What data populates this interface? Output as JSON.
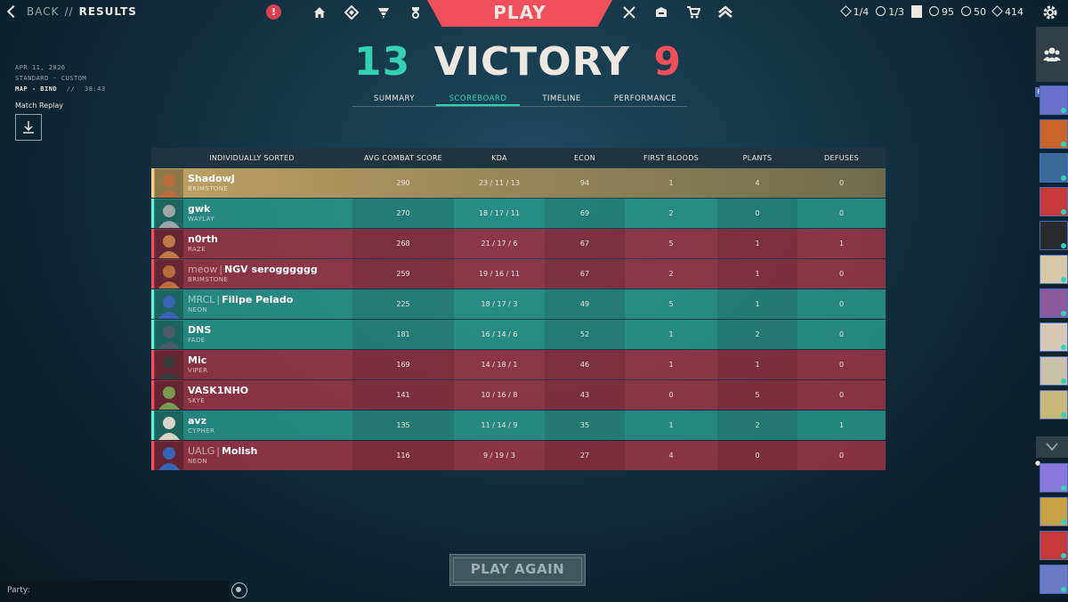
{
  "nav": {
    "back_label": "BACK",
    "separator": "//",
    "section_title": "RESULTS",
    "alert_icon": "!",
    "play_label": "PLAY",
    "left_icons": [
      "home-icon",
      "career-icon",
      "collection-icon",
      "battlepass-icon"
    ],
    "right_icons": [
      "agents-icon",
      "store-box-icon",
      "store-cart-icon",
      "rank-icon"
    ]
  },
  "currency": {
    "missions": "1/4",
    "challenges": "1/3",
    "valorant_points": "95",
    "radianite": "50",
    "kingdom_credits": "414"
  },
  "match": {
    "date": "APR 11, 2026",
    "mode": "STANDARD - CUSTOM",
    "map": "MAP - BIND",
    "map_separator": "//",
    "duration": "38:43",
    "replay_label": "Match Replay",
    "score_ally": "13",
    "result": "VICTORY",
    "score_enemy": "9"
  },
  "tabs": [
    "SUMMARY",
    "SCOREBOARD",
    "TIMELINE",
    "PERFORMANCE"
  ],
  "active_tab": "SCOREBOARD",
  "columns": [
    "INDIVIDUALLY SORTED",
    "AVG COMBAT SCORE",
    "KDA",
    "ECON",
    "FIRST BLOODS",
    "PLANTS",
    "DEFUSES"
  ],
  "players": [
    {
      "team": "self",
      "tag": "",
      "name": "ShadowJ",
      "agent": "BRIMSTONE",
      "acs": "290",
      "kda": "23 / 11 / 13",
      "econ": "94",
      "first_bloods": "1",
      "plants": "4",
      "defuses": "0",
      "avatar_color": "#b86d3a"
    },
    {
      "team": "ally",
      "tag": "",
      "name": "gwk",
      "agent": "WAYLAY",
      "acs": "270",
      "kda": "18 / 17 / 11",
      "econ": "69",
      "first_bloods": "2",
      "plants": "0",
      "defuses": "0",
      "avatar_color": "#9aa7a6"
    },
    {
      "team": "enemy",
      "tag": "",
      "name": "n0rth",
      "agent": "RAZE",
      "acs": "268",
      "kda": "21 / 17 / 6",
      "econ": "67",
      "first_bloods": "5",
      "plants": "1",
      "defuses": "1",
      "avatar_color": "#c07a45"
    },
    {
      "team": "enemy",
      "tag": "meow",
      "name": "NGV serogggggg",
      "agent": "BRIMSTONE",
      "acs": "259",
      "kda": "19 / 16 / 11",
      "econ": "67",
      "first_bloods": "2",
      "plants": "1",
      "defuses": "0",
      "avatar_color": "#b86d3a"
    },
    {
      "team": "ally",
      "tag": "MRCL",
      "name": "Filipe Pelado",
      "agent": "NEON",
      "acs": "225",
      "kda": "18 / 17 / 3",
      "econ": "49",
      "first_bloods": "5",
      "plants": "1",
      "defuses": "0",
      "avatar_color": "#3a62b5"
    },
    {
      "team": "ally",
      "tag": "",
      "name": "DNS",
      "agent": "FADE",
      "acs": "181",
      "kda": "16 / 14 / 6",
      "econ": "52",
      "first_bloods": "1",
      "plants": "2",
      "defuses": "0",
      "avatar_color": "#4a5a66"
    },
    {
      "team": "enemy",
      "tag": "",
      "name": "Mic",
      "agent": "VIPER",
      "acs": "169",
      "kda": "14 / 18 / 1",
      "econ": "46",
      "first_bloods": "1",
      "plants": "1",
      "defuses": "0",
      "avatar_color": "#3a3a3e"
    },
    {
      "team": "enemy",
      "tag": "",
      "name": "VASK1NHO",
      "agent": "SKYE",
      "acs": "141",
      "kda": "10 / 16 / 8",
      "econ": "43",
      "first_bloods": "0",
      "plants": "5",
      "defuses": "0",
      "avatar_color": "#7a9a52"
    },
    {
      "team": "ally",
      "tag": "",
      "name": "avz",
      "agent": "CYPHER",
      "acs": "135",
      "kda": "11 / 14 / 9",
      "econ": "35",
      "first_bloods": "1",
      "plants": "2",
      "defuses": "1",
      "avatar_color": "#d8d4c8"
    },
    {
      "team": "enemy",
      "tag": "UALG",
      "name": "Molish",
      "agent": "NEON",
      "acs": "116",
      "kda": "9 / 19 / 3",
      "econ": "27",
      "first_bloods": "4",
      "plants": "0",
      "defuses": "0",
      "avatar_color": "#3a62b5"
    }
  ],
  "play_again_label": "PLAY AGAIN",
  "party_label": "Party:",
  "social": {
    "online_count": "8",
    "friends_colors": [
      "#6a6fc8",
      "#c8642a",
      "#3a6a9a",
      "#c83a3a",
      "#2a2a2e",
      "#d8c8a8",
      "#8a5a9a",
      "#d8c8b8",
      "#c8c0a8",
      "#c8b878",
      "#8a78d8",
      "#c8a048",
      "#c83a3a",
      "#6a7ac8"
    ]
  }
}
